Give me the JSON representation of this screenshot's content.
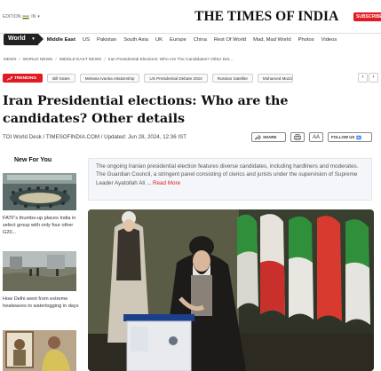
{
  "header": {
    "edition_label": "EDITION",
    "edition_value": "IN",
    "logo": "THE TIMES OF INDIA",
    "subscribe_label": "SUBSCRIBE"
  },
  "nav": {
    "world_label": "World",
    "items": [
      "Middle East",
      "US",
      "Pakistan",
      "South Asia",
      "UK",
      "Europe",
      "China",
      "Rest Of World",
      "Mad, Mad World",
      "Photos",
      "Videos"
    ]
  },
  "breadcrumb": {
    "items": [
      "NEWS",
      "WORLD NEWS",
      "MIDDLE EAST NEWS",
      "Iran Presidential Elections: Who Are The Candidates? Other Det..."
    ]
  },
  "trending": {
    "label": "TRENDING",
    "chips": [
      "Bill Gates",
      "Melania Ivanka relationship",
      "US Presidential Debate 2024",
      "Russian Satellite",
      "Mohamed Muizz"
    ]
  },
  "article": {
    "title": "Iran Presidential elections: Who are the candidates? Other details",
    "byline": "TOI World Desk / TIMESOFINDIA.COM / Updated: Jun 28, 2024, 12:36 IST",
    "share_label": "SHARE",
    "aa_label": "AA",
    "follow_label": "FOLLOW US",
    "summary": "The ongoing Iranian presidential election features diverse candidates, including hardliners and moderates. The Guardian Council, a stringent panel consisting of clerics and jurists under the supervision of Supreme Leader Ayatollah Ali ...",
    "read_more": "Read More"
  },
  "sidebar": {
    "title": "New For You",
    "cards": [
      {
        "text": "FATF's thumbs-up places India in select group with only four other G20..."
      },
      {
        "text": "How Delhi went from extreme heatwaves to waterlogging in days"
      },
      {
        "text": ""
      }
    ]
  },
  "colors": {
    "brand_red": "#e21b22",
    "nav_dark": "#222222"
  }
}
